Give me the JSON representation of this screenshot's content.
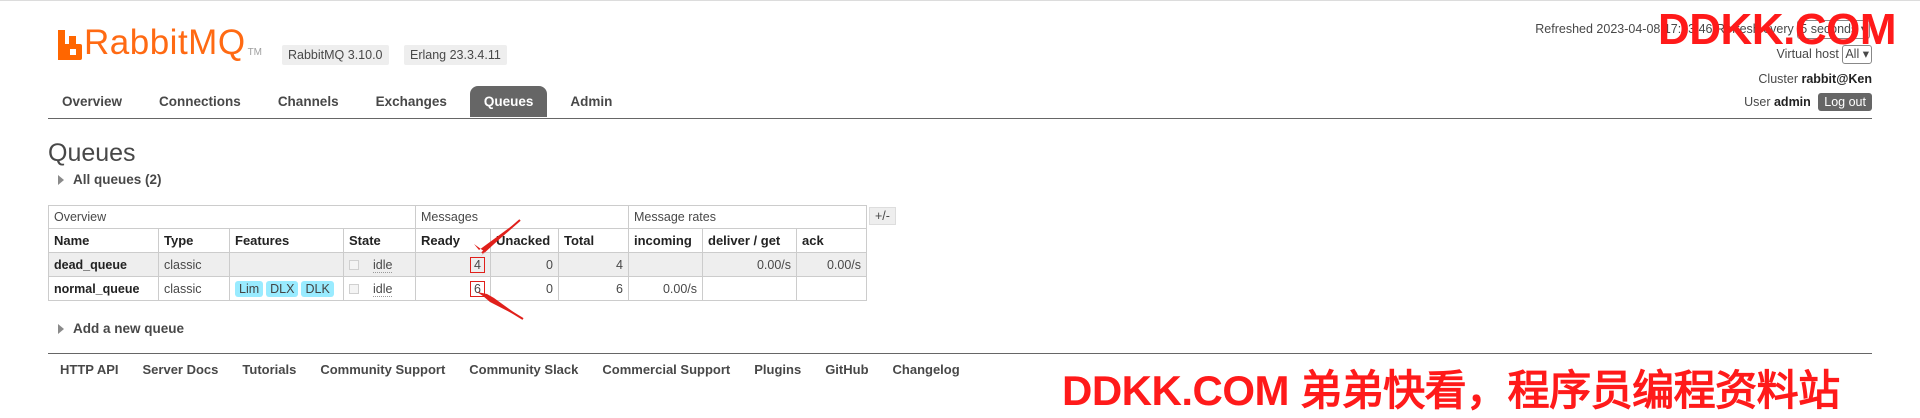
{
  "app": {
    "logo_text": "RabbitMQ",
    "logo_tm": "TM",
    "version_badge": "RabbitMQ 3.10.0",
    "erlang_badge": "Erlang 23.3.4.11",
    "brand_color": "#ff6600"
  },
  "header": {
    "refreshed_label": "Refreshed 2023-04-08 17:13:46",
    "refresh_label": "Refresh every",
    "refresh_interval": "5 seconds",
    "vhost_label": "Virtual host",
    "vhost_value": "All",
    "cluster_label": "Cluster",
    "cluster_value": "rabbit@Ken",
    "user_label": "User",
    "user_value": "admin",
    "logout_label": "Log out"
  },
  "tabs": [
    {
      "label": "Overview"
    },
    {
      "label": "Connections"
    },
    {
      "label": "Channels"
    },
    {
      "label": "Exchanges"
    },
    {
      "label": "Queues",
      "active": true
    },
    {
      "label": "Admin"
    }
  ],
  "page": {
    "title": "Queues",
    "all_queues_label": "All queues (2)",
    "add_queue_label": "Add a new queue",
    "plus_minus": "+/-"
  },
  "table": {
    "groups": {
      "overview": "Overview",
      "messages": "Messages",
      "rates": "Message rates"
    },
    "columns": [
      "Name",
      "Type",
      "Features",
      "State",
      "Ready",
      "Unacked",
      "Total",
      "incoming",
      "deliver / get",
      "ack"
    ],
    "rows": [
      {
        "name": "dead_queue",
        "type": "classic",
        "features": [],
        "state": "idle",
        "ready": "4",
        "unacked": "0",
        "total": "4",
        "incoming": "",
        "deliver_get": "0.00/s",
        "ack": "0.00/s"
      },
      {
        "name": "normal_queue",
        "type": "classic",
        "features": [
          "Lim",
          "DLX",
          "DLK"
        ],
        "state": "idle",
        "ready": "6",
        "unacked": "0",
        "total": "6",
        "incoming": "0.00/s",
        "deliver_get": "",
        "ack": ""
      }
    ]
  },
  "footer": {
    "links": [
      "HTTP API",
      "Server Docs",
      "Tutorials",
      "Community Support",
      "Community Slack",
      "Commercial Support",
      "Plugins",
      "GitHub",
      "Changelog"
    ]
  },
  "watermarks": {
    "top": "DDKK.COM",
    "bottom": "DDKK.COM 弟弟快看，程序员编程资料站",
    "color": "#ff1a1a"
  },
  "annotation_color": "#e0201b"
}
